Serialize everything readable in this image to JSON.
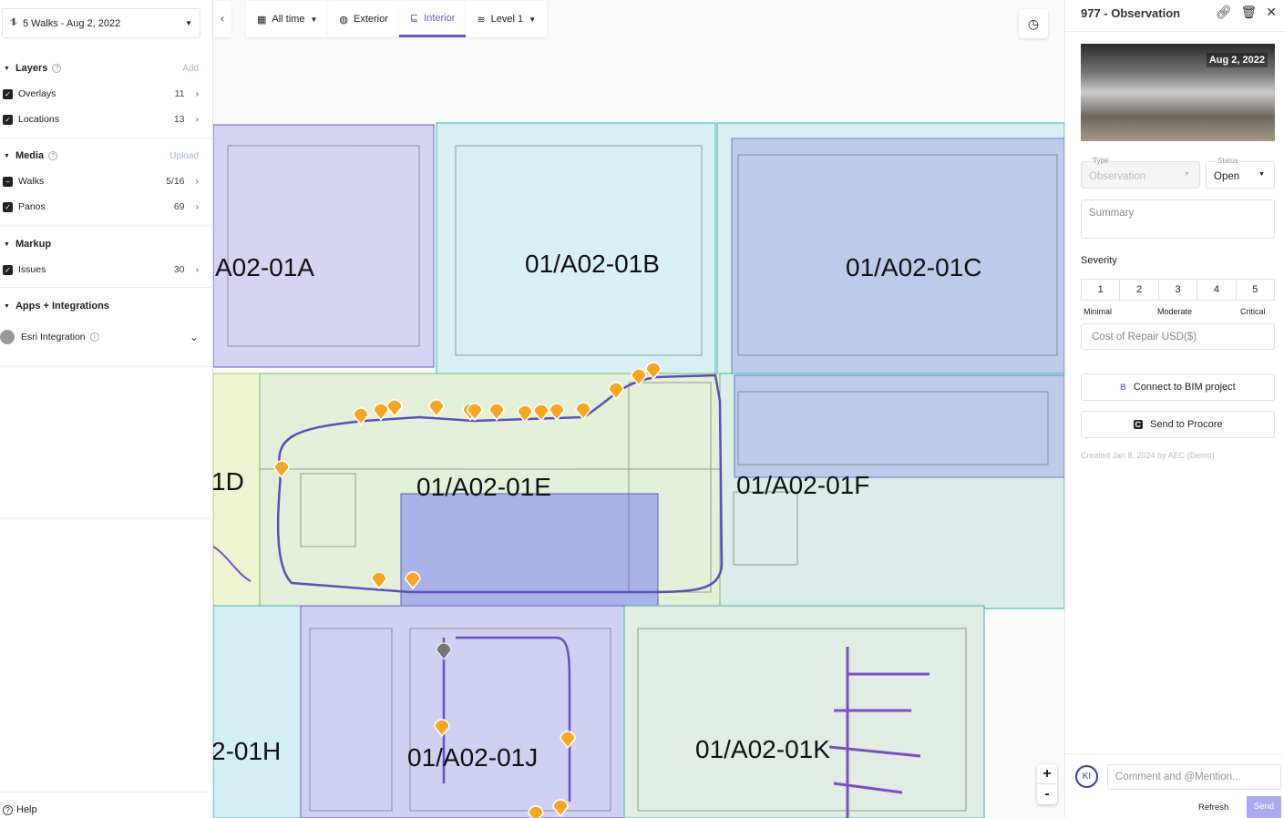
{
  "walk_selector": {
    "label": "5 Walks - Aug 2, 2022"
  },
  "sidebar": {
    "layers": {
      "title": "Layers",
      "action": "Add",
      "items": [
        {
          "label": "Overlays",
          "count": "11"
        },
        {
          "label": "Locations",
          "count": "13"
        }
      ]
    },
    "media": {
      "title": "Media",
      "action": "Upload",
      "items": [
        {
          "label": "Walks",
          "count": "5/16"
        },
        {
          "label": "Panos",
          "count": "69"
        }
      ]
    },
    "markup": {
      "title": "Markup",
      "items": [
        {
          "label": "Issues",
          "count": "30"
        }
      ]
    },
    "apps": {
      "title": "Apps + Integrations",
      "items": [
        {
          "label": "Esri Integration"
        }
      ]
    },
    "help": "Help"
  },
  "toolbar": {
    "time": "All time",
    "exterior": "Exterior",
    "interior": "Interior",
    "level": "Level 1"
  },
  "map": {
    "zones": [
      "A02-01A",
      "01/A02-01B",
      "01/A02-01C",
      "1D",
      "01/A02-01E",
      "01/A02-01F",
      "2-01H",
      "01/A02-01J",
      "01/A02-01K"
    ],
    "zoom_in": "+",
    "zoom_out": "-",
    "accent": "#5b5fc7",
    "marker_color": "#f5a623"
  },
  "panel": {
    "title": "977 - Observation",
    "pano_date": "Aug 2, 2022",
    "type_label": "Type",
    "type_value": "Observation",
    "status_label": "Status",
    "status_value": "Open",
    "summary_placeholder": "Summary",
    "severity_label": "Severity",
    "severity": [
      "1",
      "2",
      "3",
      "4",
      "5"
    ],
    "severity_min": "Minimal",
    "severity_mid": "Moderate",
    "severity_max": "Critical",
    "cost_placeholder": "Cost of Repair USD($)",
    "bim_button": "Connect to BIM project",
    "procore_button": "Send to Procore",
    "created": "Created Jan 8, 2024 by AEC (Demo)",
    "avatar": "KI",
    "comment_placeholder": "Comment and @Mention...",
    "refresh": "Refresh",
    "send": "Send"
  }
}
